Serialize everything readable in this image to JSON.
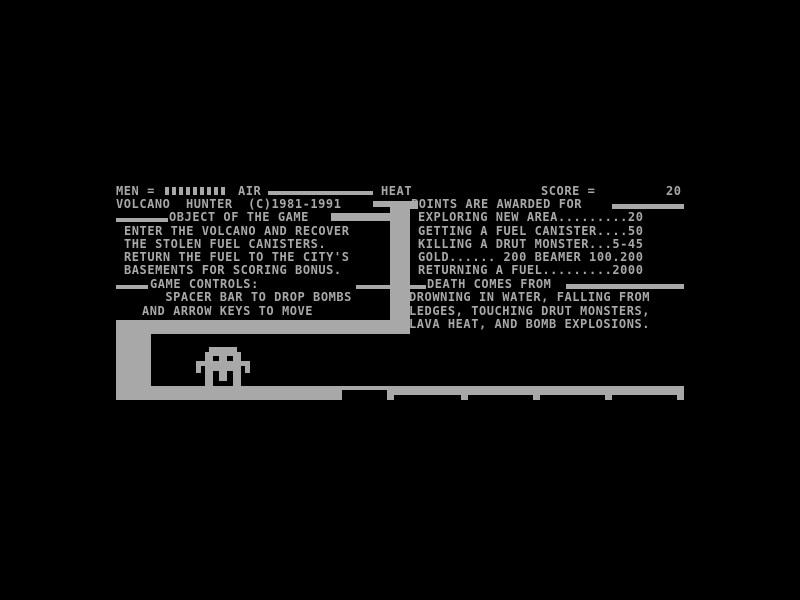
{
  "hud": {
    "men_label": "MEN =",
    "men_count": 9,
    "air_label": "AIR",
    "heat_label": "HEAT",
    "score_label": "SCORE =",
    "score_value": "20"
  },
  "title": "VOLCANO  HUNTER  (C)1981-1991",
  "object": {
    "heading": "OBJECT OF THE GAME",
    "lines": [
      "ENTER THE VOLCANO AND RECOVER",
      "THE STOLEN FUEL CANISTERS.",
      "RETURN THE FUEL TO THE CITY'S",
      "BASEMENTS FOR SCORING BONUS."
    ]
  },
  "controls": {
    "heading": "GAME CONTROLS:",
    "lines": [
      "   SPACER BAR TO DROP BOMBS",
      "AND ARROW KEYS TO MOVE"
    ]
  },
  "points": {
    "heading": "POINTS ARE AWARDED FOR",
    "lines": [
      "EXPLORING NEW AREA.........20",
      "GETTING A FUEL CANISTER....50",
      "KILLING A DRUT MONSTER...5-45",
      "GOLD...... 200 BEAMER 100.200",
      "RETURNING A FUEL.........2000"
    ]
  },
  "death": {
    "heading": "DEATH COMES FROM",
    "lines": [
      "DROWNING IN WATER, FALLING FROM",
      "LEDGES, TOUCHING DRUT MONSTERS,",
      "LAVA HEAT, AND BOMB EXPLOSIONS."
    ]
  },
  "colors": {
    "foreground": "#a8a8a8",
    "background": "#000000"
  }
}
